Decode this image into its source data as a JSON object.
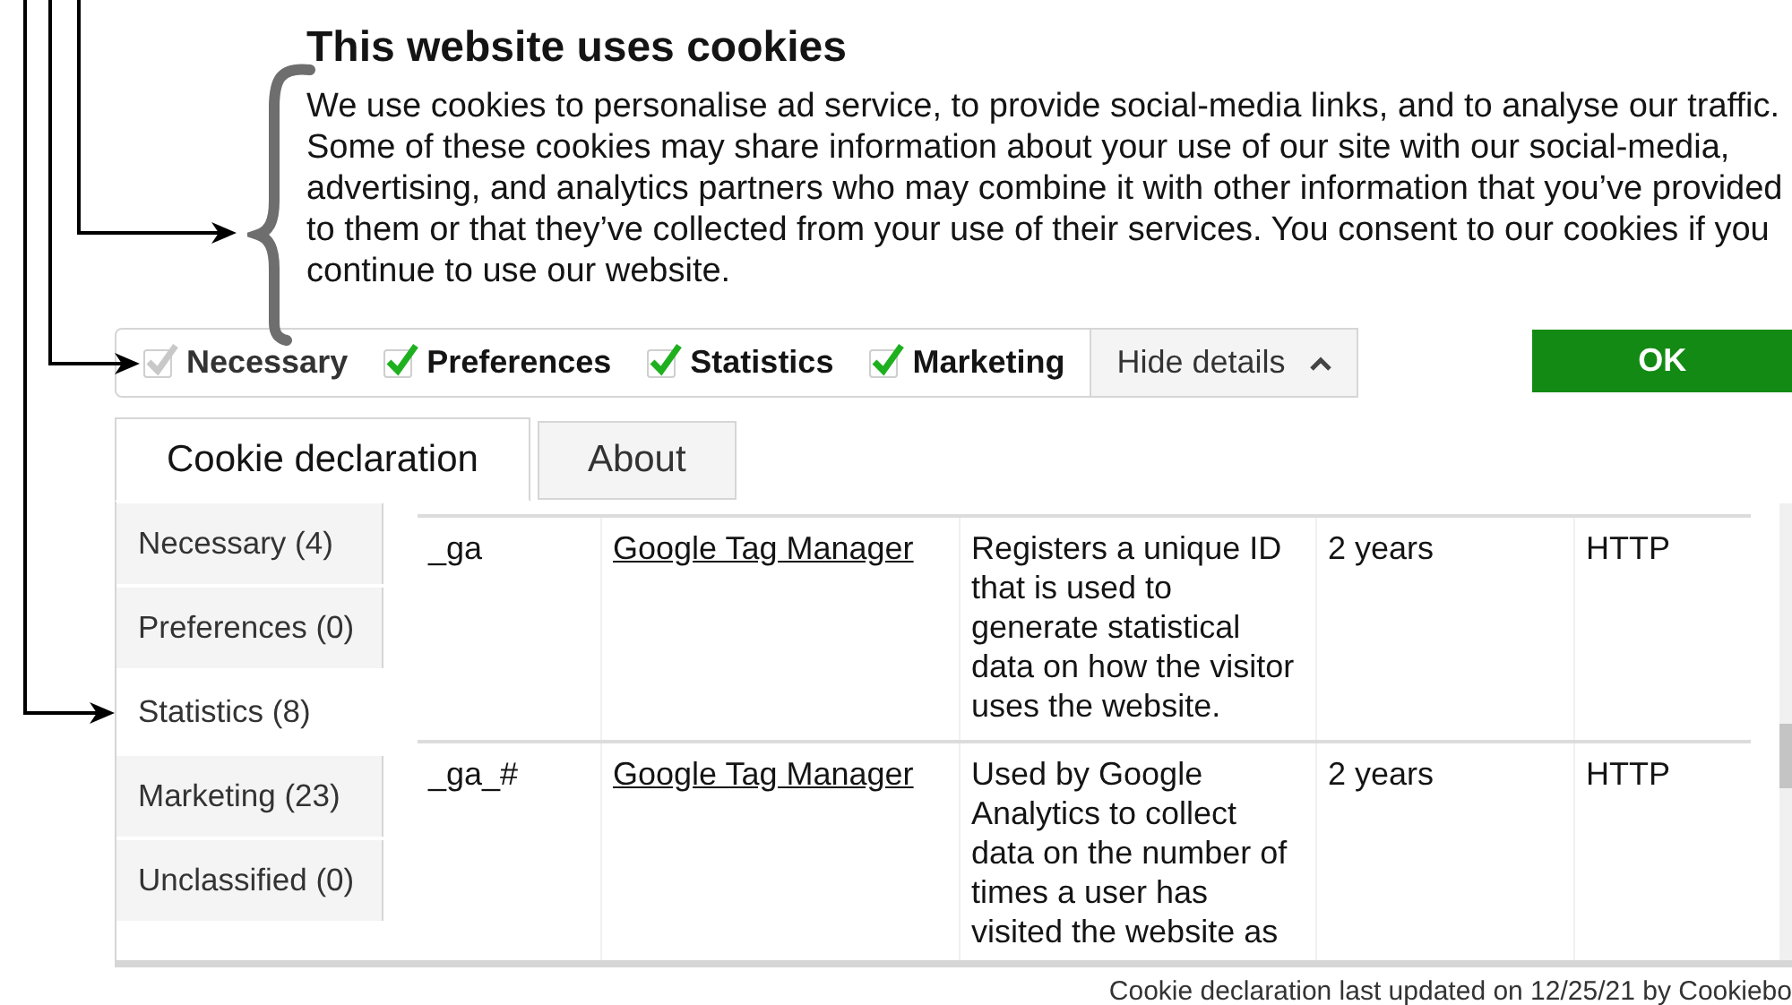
{
  "banner": {
    "title": "This website uses cookies",
    "text": "We use cookies to personalise ad service, to provide social-media links, and to analyse our traffic. Some of these cookies may share information about your use of our site with our social-media, advertising, and analytics partners who may combine it with other information that you’ve provided to them or that they’ve collected from your use of their services. You consent to our cookies if you continue to use our website."
  },
  "consent_options": [
    {
      "label": "Necessary",
      "checked": true,
      "disabled": true
    },
    {
      "label": "Preferences",
      "checked": true,
      "disabled": false
    },
    {
      "label": "Statistics",
      "checked": true,
      "disabled": false
    },
    {
      "label": "Marketing",
      "checked": true,
      "disabled": false
    }
  ],
  "details_toggle": {
    "label": "Hide details",
    "expanded": true
  },
  "ok_button": "OK",
  "tabs": [
    {
      "label": "Cookie declaration",
      "selected": true
    },
    {
      "label": "About",
      "selected": false
    }
  ],
  "categories": [
    {
      "label": "Necessary (4)",
      "selected": false
    },
    {
      "label": "Preferences (0)",
      "selected": false
    },
    {
      "label": "Statistics (8)",
      "selected": true
    },
    {
      "label": "Marketing (23)",
      "selected": false
    },
    {
      "label": "Unclassified (0)",
      "selected": false
    }
  ],
  "table": {
    "rows": [
      {
        "cells": [
          "_ga",
          "Google Tag Manager",
          "Registers a unique ID that is used to generate statistical data on how the visitor uses the website.",
          "2 years",
          "HTTP"
        ]
      },
      {
        "cells": [
          "_ga_#",
          "Google Tag Manager",
          "Used by Google Analytics to collect data on the number of times a user has visited the website as",
          "2 years",
          "HTTP"
        ]
      }
    ]
  },
  "footer": "Cookie declaration last updated on 12/25/21 by Cookiebo"
}
